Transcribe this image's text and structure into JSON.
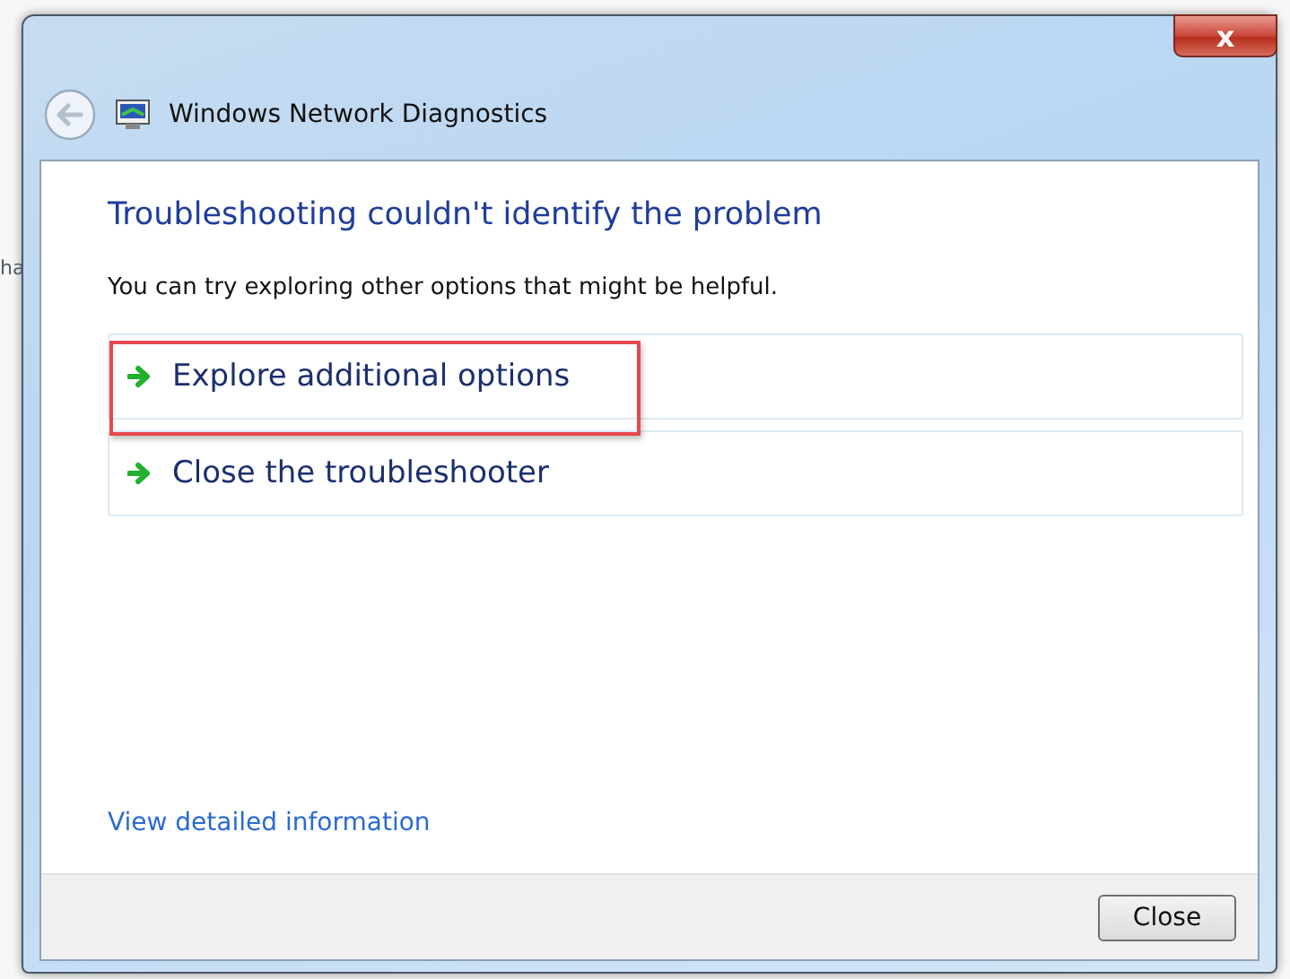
{
  "background_window": {
    "text_fragment": "ha"
  },
  "window": {
    "title": "Windows Network Diagnostics",
    "close_glyph": "x"
  },
  "heading": "Troubleshooting couldn't identify the problem",
  "message": "You can try exploring other options that might be helpful.",
  "options": [
    {
      "label": "Explore additional options",
      "highlighted": true
    },
    {
      "label": "Close the troubleshooter",
      "highlighted": false
    }
  ],
  "details_link": "View detailed information",
  "buttons": [
    "Close"
  ]
}
